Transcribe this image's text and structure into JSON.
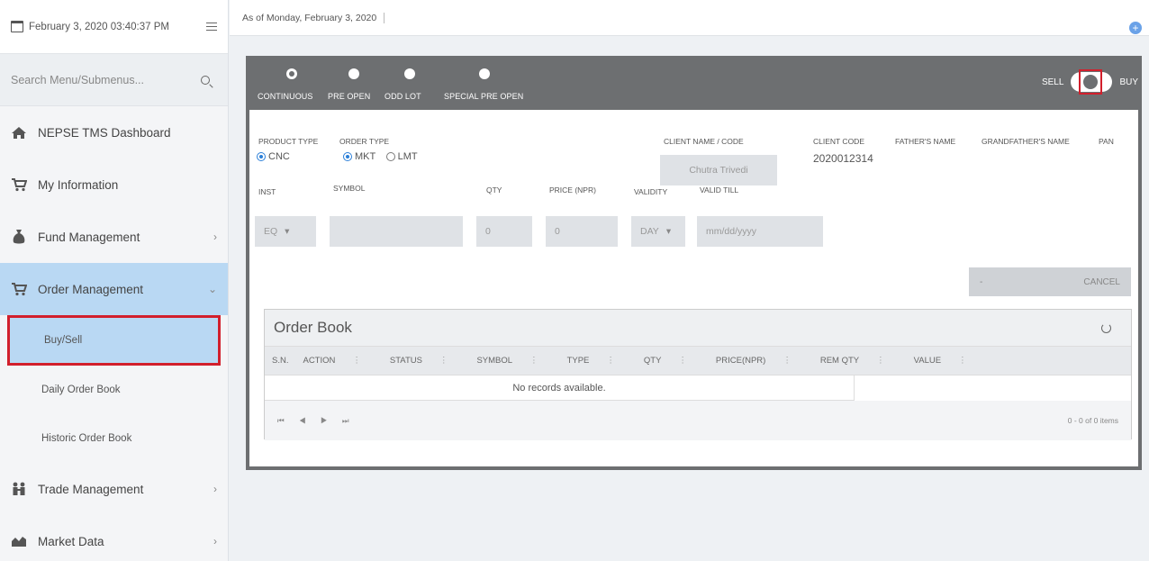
{
  "sidebar": {
    "datetime": "February 3, 2020 03:40:37 PM",
    "search_placeholder": "Search Menu/Submenus...",
    "items": [
      {
        "label": "NEPSE TMS Dashboard"
      },
      {
        "label": "My Information"
      },
      {
        "label": "Fund Management"
      },
      {
        "label": "Order Management"
      },
      {
        "label": "Trade Management"
      },
      {
        "label": "Market Data"
      }
    ],
    "sub_items": [
      {
        "label": "Buy/Sell"
      },
      {
        "label": "Daily Order Book"
      },
      {
        "label": "Historic Order Book"
      }
    ]
  },
  "topbar": {
    "as_of": "As of Monday, February 3, 2020",
    "add_icon": "+"
  },
  "order_form": {
    "modes": [
      "CONTINUOUS",
      "PRE OPEN",
      "ODD LOT",
      "SPECIAL PRE OPEN"
    ],
    "sell_label": "SELL",
    "buy_label": "BUY",
    "labels": {
      "product_type": "PRODUCT TYPE",
      "order_type": "ORDER TYPE",
      "client_name": "CLIENT NAME / CODE",
      "client_code": "CLIENT CODE",
      "fathers_name": "FATHER'S NAME",
      "grandfathers_name": "GRANDFATHER'S NAME",
      "pan": "PAN",
      "inst": "INST",
      "symbol": "SYMBOL",
      "qty": "QTY",
      "price": "PRICE (NPR)",
      "validity": "VALIDITY",
      "valid_till": "VALID TILL"
    },
    "product_options": [
      "CNC"
    ],
    "order_options": [
      "MKT",
      "LMT"
    ],
    "client_name_value": "Chutra Trivedi",
    "client_code_value": "2020012314",
    "inst_value": "EQ",
    "qty_value": "0",
    "price_value": "0",
    "validity_value": "DAY",
    "valid_till_placeholder": "mm/dd/yyyy",
    "btn_dash": "-",
    "cancel_label": "CANCEL"
  },
  "order_book": {
    "title": "Order Book",
    "columns": [
      "S.N.",
      "ACTION",
      "STATUS",
      "SYMBOL",
      "TYPE",
      "QTY",
      "PRICE(NPR)",
      "REM QTY",
      "VALUE"
    ],
    "empty_text": "No records available.",
    "pager_text": "0 - 0 of 0 items",
    "pager_nav": "⏮ ◀ ▶ ⏭"
  }
}
